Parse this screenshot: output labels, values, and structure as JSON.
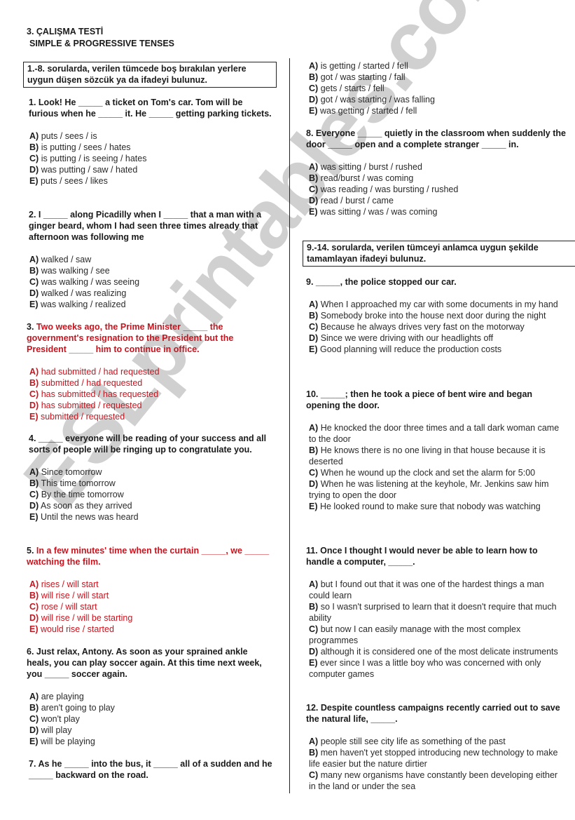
{
  "header": {
    "title": "3. ÇALIŞMA TESTİ",
    "subtitle": "SIMPLE & PROGRESSIVE TENSES"
  },
  "watermark": "ESLprintables.com",
  "colors": {
    "highlight_red": "#c8141e",
    "text": "#1a1a1a",
    "watermark": "#c8c8c8"
  },
  "instructions": {
    "part1": "1.-8. sorularda, verilen tümcede boş bırakılan yerlere uygun düşen sözcük ya da ifadeyi bulunuz.",
    "part2": "9.-14. sorularda, verilen tümceyi anlamca uygun şekilde tamamlayan ifadeyi bulunuz."
  },
  "questions": [
    {
      "number": "1.",
      "text": "Look! He _____ a ticket on Tom's car. Tom will be furious when he _____ it. He _____ getting parking tickets.",
      "highlighted": false,
      "options": [
        {
          "letter": "A)",
          "text": "puts / sees / is"
        },
        {
          "letter": "B)",
          "text": "is putting / sees / hates"
        },
        {
          "letter": "C)",
          "text": "is putting / is seeing / hates"
        },
        {
          "letter": "D)",
          "text": "was putting / saw / hated"
        },
        {
          "letter": "E)",
          "text": "puts / sees / likes"
        }
      ]
    },
    {
      "number": "2.",
      "text": "I _____ along Picadilly when I _____ that a man with a ginger beard, whom I had seen three times already that afternoon was following me",
      "highlighted": false,
      "options": [
        {
          "letter": "A)",
          "text": "walked / saw"
        },
        {
          "letter": "B)",
          "text": "was walking / see"
        },
        {
          "letter": "C)",
          "text": "was walking / was seeing"
        },
        {
          "letter": "D)",
          "text": "walked / was realizing"
        },
        {
          "letter": "E)",
          "text": "was walking / realized"
        }
      ]
    },
    {
      "number": "3.",
      "text": "Two weeks ago, the Prime Minister _____ the government's resignation to the President but the President _____ him to continue in office.",
      "highlighted": true,
      "options": [
        {
          "letter": "A)",
          "text": "had submitted / had requested"
        },
        {
          "letter": "B)",
          "text": "submitted / had requested"
        },
        {
          "letter": "C)",
          "text": "has submitted / has requested"
        },
        {
          "letter": "D)",
          "text": "has submitted / requested"
        },
        {
          "letter": "E)",
          "text": "submitted / requested"
        }
      ]
    },
    {
      "number": "4.",
      "text": "_____ everyone will be reading of your success and all sorts of people will be ringing up to congratulate you.",
      "highlighted": false,
      "options": [
        {
          "letter": "A)",
          "text": "Since tomorrow"
        },
        {
          "letter": "B)",
          "text": "This time tomorrow"
        },
        {
          "letter": "C)",
          "text": "By the time tomorrow"
        },
        {
          "letter": "D)",
          "text": "As soon as they arrived"
        },
        {
          "letter": "E)",
          "text": "Until the news was heard"
        }
      ]
    },
    {
      "number": "5.",
      "text": "In a few minutes' time when the curtain _____, we _____ watching the film.",
      "highlighted": true,
      "options": [
        {
          "letter": "A)",
          "text": "rises / will start"
        },
        {
          "letter": "B)",
          "text": "will rise / will start"
        },
        {
          "letter": "C)",
          "text": "rose / will start"
        },
        {
          "letter": "D)",
          "text": "will rise / will be starting"
        },
        {
          "letter": "E)",
          "text": "would rise / started"
        }
      ]
    },
    {
      "number": "6.",
      "text": "Just relax, Antony. As soon as your sprained ankle heals, you can play soccer again. At this time next week, you _____ soccer again.",
      "highlighted": false,
      "options": [
        {
          "letter": "A)",
          "text": "are playing"
        },
        {
          "letter": "B)",
          "text": "aren't going to play"
        },
        {
          "letter": "C)",
          "text": "won't play"
        },
        {
          "letter": "D)",
          "text": "will play"
        },
        {
          "letter": "E)",
          "text": "will be playing"
        }
      ]
    },
    {
      "number": "7.",
      "text": "As he _____ into the bus, it _____ all of a sudden and he _____ backward on the road.",
      "highlighted": false,
      "options": [
        {
          "letter": "A)",
          "text": "is getting / started / fell"
        },
        {
          "letter": "B)",
          "text": "got / was starting / fall"
        },
        {
          "letter": "C)",
          "text": "gets / starts / fell"
        },
        {
          "letter": "D)",
          "text": "got / was starting / was falling"
        },
        {
          "letter": "E)",
          "text": "was getting / started / fell"
        }
      ]
    },
    {
      "number": "8.",
      "text": "Everyone _____ quietly in the classroom when suddenly the door _____ open and a complete stranger _____ in.",
      "highlighted": false,
      "options": [
        {
          "letter": "A)",
          "text": "was sitting / burst / rushed"
        },
        {
          "letter": "B)",
          "text": "read/burst / was coming"
        },
        {
          "letter": "C)",
          "text": "was reading / was bursting / rushed"
        },
        {
          "letter": "D)",
          "text": "read / burst / came"
        },
        {
          "letter": "E)",
          "text": "was sitting / was / was coming"
        }
      ]
    },
    {
      "number": "9.",
      "text": "_____, the police stopped our car.",
      "highlighted": false,
      "options": [
        {
          "letter": "A)",
          "text": "When I approached my car with some documents in my hand"
        },
        {
          "letter": "B)",
          "text": "Somebody broke into the house next door during the night"
        },
        {
          "letter": "C)",
          "text": "Because he always drives very fast on the motorway"
        },
        {
          "letter": "D)",
          "text": "Since we were driving with our headlights off"
        },
        {
          "letter": "E)",
          "text": "Good planning will reduce the production costs"
        }
      ]
    },
    {
      "number": "10.",
      "text": "_____; then he took a piece of bent wire and began opening the door.",
      "highlighted": false,
      "options": [
        {
          "letter": "A)",
          "text": "He knocked the door three times and a tall dark woman came to the door"
        },
        {
          "letter": "B)",
          "text": "He knows there is no one living in that house because it is deserted"
        },
        {
          "letter": "C)",
          "text": "When he wound up the clock and set the alarm for 5:00"
        },
        {
          "letter": "D)",
          "text": "When he was listening at the keyhole, Mr. Jenkins saw him trying to open the door"
        },
        {
          "letter": "E)",
          "text": "He looked round to make sure that nobody was watching"
        }
      ]
    },
    {
      "number": "11.",
      "text": "Once I thought I would never be able to learn how to handle a computer, _____.",
      "highlighted": false,
      "options": [
        {
          "letter": "A)",
          "text": "but I found out that it was one of the hardest things a man could learn"
        },
        {
          "letter": "B)",
          "text": "so I wasn't surprised to learn that it doesn't require that much ability"
        },
        {
          "letter": "C)",
          "text": "but now I can easily manage with the most complex programmes"
        },
        {
          "letter": "D)",
          "text": "although it is considered one of the most delicate instruments"
        },
        {
          "letter": "E)",
          "text": "ever since I was a little boy who was concerned with only computer games"
        }
      ]
    },
    {
      "number": "12.",
      "text": "Despite countless campaigns recently carried out to save the natural life, _____.",
      "highlighted": false,
      "options": [
        {
          "letter": "A)",
          "text": "people still see city life as something of the past"
        },
        {
          "letter": "B)",
          "text": "men haven't yet stopped introducing new technology to make life easier but the nature dirtier"
        },
        {
          "letter": "C)",
          "text": "many new organisms have constantly been developing either in the land or under the sea"
        }
      ]
    }
  ]
}
